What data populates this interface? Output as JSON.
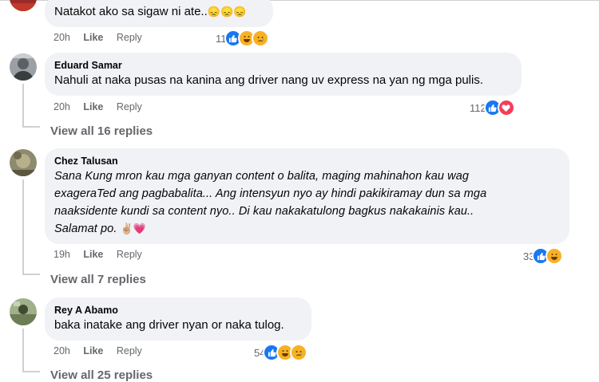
{
  "comments": [
    {
      "text": "Natakot ako sa sigaw ni ate..",
      "emojis": "😞😞😞",
      "time": "20h",
      "like_label": "Like",
      "reply_label": "Reply",
      "reaction_count": "11",
      "reactions": [
        "like",
        "haha",
        "sad"
      ]
    },
    {
      "author": "Eduard Samar",
      "text": "Nahuli at naka pusas na kanina ang driver nang uv express na yan ng mga pulis.",
      "time": "20h",
      "like_label": "Like",
      "reply_label": "Reply",
      "reaction_count": "112",
      "reactions": [
        "like",
        "love"
      ],
      "view_replies": "View all 16 replies"
    },
    {
      "author": "Chez Talusan",
      "lines": [
        "Sana Kung mron kau mga ganyan content o balita, maging mahinahon kau wag",
        "exageraTed ang pagbabalita... Ang intensyun nyo ay hindi pakikiramay dun sa mga",
        "naaksidente kundi sa content nyo.. Di kau nakakatulong bagkus nakakainis kau..",
        "Salamat po."
      ],
      "emojis": "✌🏼💗",
      "time": "19h",
      "like_label": "Like",
      "reply_label": "Reply",
      "reaction_count": "33",
      "reactions": [
        "like",
        "haha"
      ],
      "view_replies": "View all 7 replies"
    },
    {
      "author": "Rey A Abamo",
      "text": "baka inatake ang driver nyan or naka tulog.",
      "time": "20h",
      "like_label": "Like",
      "reply_label": "Reply",
      "reaction_count": "54",
      "reactions": [
        "like",
        "haha",
        "sad"
      ],
      "view_replies": "View all 25 replies"
    }
  ],
  "colors": {
    "bubble": "#f0f2f5",
    "meta_text": "#65676b",
    "like_blue": "#1877f2",
    "love_red": "#f33e58",
    "emoji_yellow": "#f7b125"
  }
}
